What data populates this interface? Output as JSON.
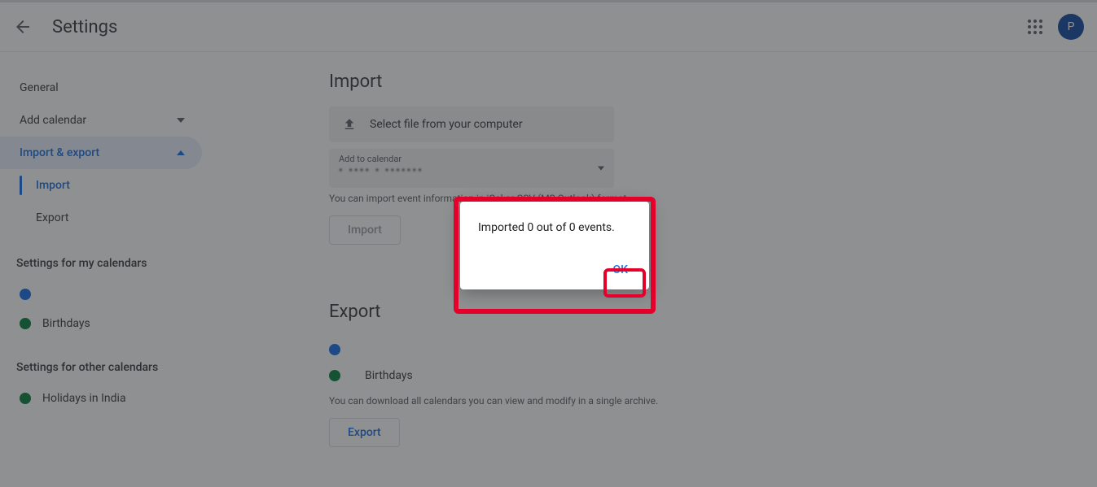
{
  "header": {
    "title": "Settings",
    "avatar_initial": "P"
  },
  "sidebar": {
    "general": "General",
    "add_calendar": "Add calendar",
    "import_export": "Import & export",
    "sub_import": "Import",
    "sub_export": "Export",
    "my_heading": "Settings for my calendars",
    "my_calendars": [
      {
        "label": "",
        "color": "#1a73e8"
      },
      {
        "label": "Birthdays",
        "color": "#0b8043"
      }
    ],
    "other_heading": "Settings for other calendars",
    "other_calendars": [
      {
        "label": "Holidays in India",
        "color": "#0b8043"
      }
    ]
  },
  "main": {
    "import_heading": "Import",
    "file_label": "Select file from your computer",
    "add_to_calendar_label": "Add to calendar",
    "add_to_calendar_value": "• •••• • •••••••",
    "import_hint": "You can import event information in iCal or CSV (MS Outlook) format.",
    "import_button": "Import",
    "export_heading": "Export",
    "export_calendars": [
      {
        "label": "",
        "color": "#1a73e8"
      },
      {
        "label": "Birthdays",
        "color": "#0b8043"
      }
    ],
    "export_hint": "You can download all calendars you can view and modify in a single archive.",
    "export_button": "Export"
  },
  "dialog": {
    "message": "Imported 0 out of 0 events.",
    "ok": "OK"
  }
}
